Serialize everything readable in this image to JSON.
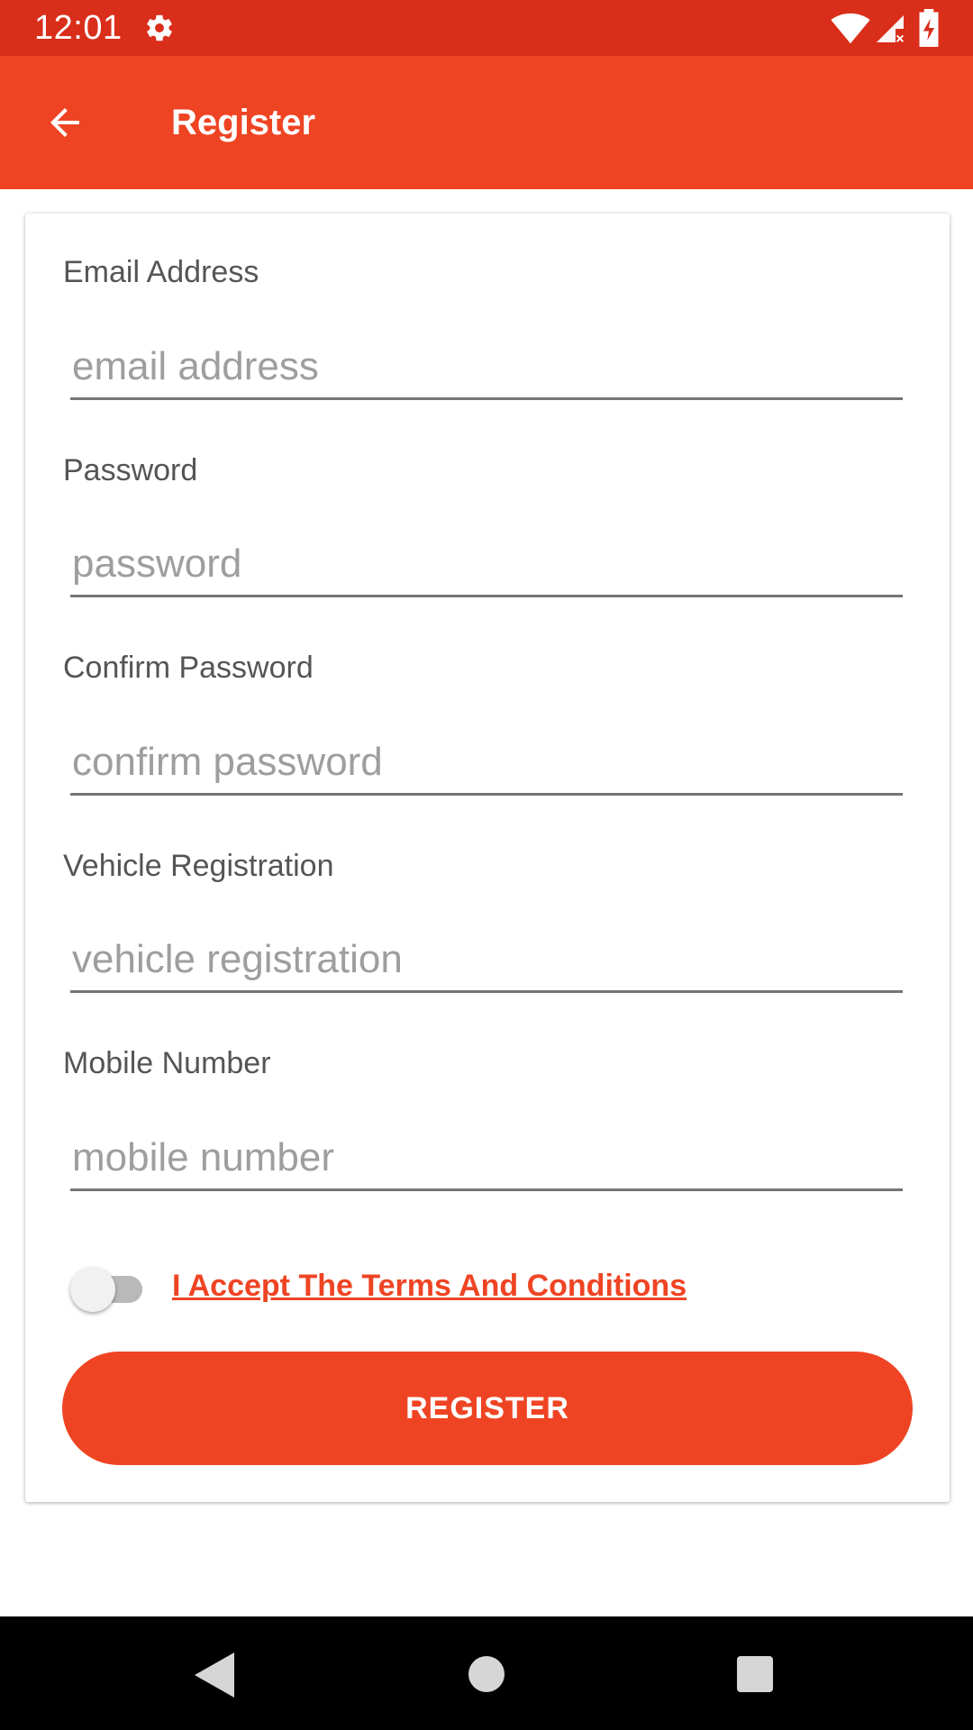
{
  "status_bar": {
    "time": "12:01",
    "icons": [
      "settings-gear-icon",
      "wifi-icon",
      "signal-icon",
      "battery-charging-icon"
    ],
    "background": "#d92e1a"
  },
  "app_bar": {
    "title": "Register",
    "back_icon": "arrow-back-icon",
    "background": "#ef4423"
  },
  "form": {
    "fields": [
      {
        "label": "Email Address",
        "placeholder": "email address",
        "value": ""
      },
      {
        "label": "Password",
        "placeholder": "password",
        "value": ""
      },
      {
        "label": "Confirm Password",
        "placeholder": "confirm password",
        "value": ""
      },
      {
        "label": "Vehicle Registration",
        "placeholder": "vehicle registration",
        "value": ""
      },
      {
        "label": "Mobile Number",
        "placeholder": "mobile number",
        "value": ""
      }
    ],
    "terms": {
      "label": "I Accept The Terms And Conditions",
      "accepted": false
    },
    "submit_label": "REGISTER"
  },
  "colors": {
    "accent": "#ef4423",
    "status_bar": "#d92e1a"
  },
  "nav_bar": {
    "icons": [
      "nav-back-icon",
      "nav-home-icon",
      "nav-recents-icon"
    ]
  }
}
